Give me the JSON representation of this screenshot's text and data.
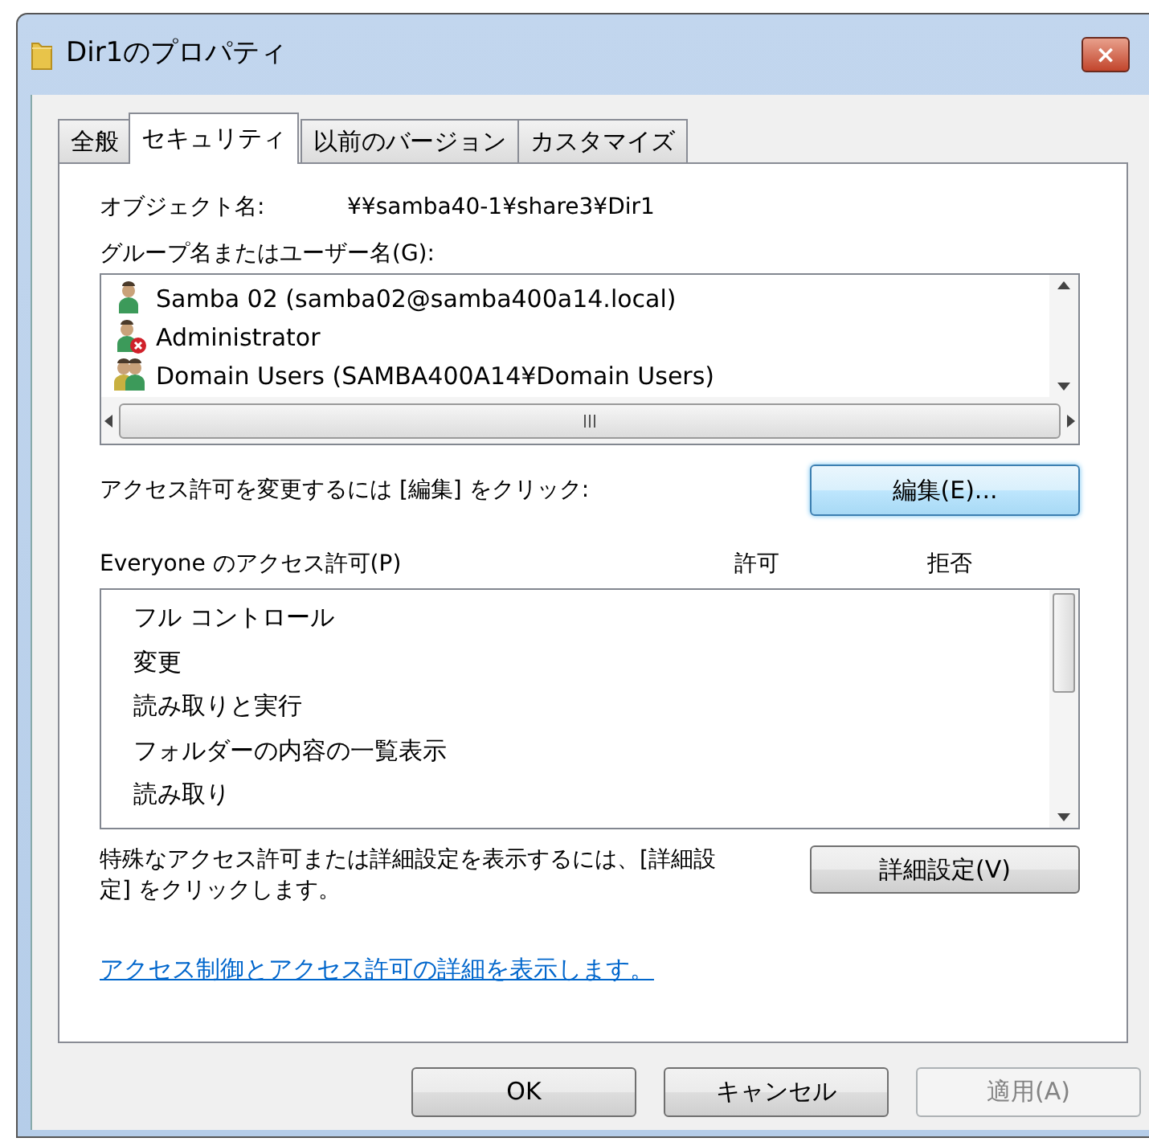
{
  "window": {
    "title": "Dir1のプロパティ",
    "close": "×"
  },
  "tabs": [
    {
      "label": "全般",
      "selected": false
    },
    {
      "label": "セキュリティ",
      "selected": true
    },
    {
      "label": "以前のバージョン",
      "selected": false
    },
    {
      "label": "カスタマイズ",
      "selected": false
    }
  ],
  "object_name": {
    "label": "オブジェクト名:",
    "value": "¥¥samba40-1¥share3¥Dir1"
  },
  "principals": {
    "label": "グループ名またはユーザー名(G):",
    "items": [
      {
        "kind": "user",
        "name": "Samba 02 (samba02@samba400a14.local)"
      },
      {
        "kind": "denied-user",
        "name": "Administrator"
      },
      {
        "kind": "group",
        "name": "Domain Users (SAMBA400A14¥Domain Users)"
      }
    ]
  },
  "edit": {
    "text": "アクセス許可を変更するには [編集] をクリック:",
    "button": "編集(E)...",
    "highlighted": true
  },
  "permissions": {
    "label": "Everyone のアクセス許可(P)",
    "columns": [
      "許可",
      "拒否"
    ],
    "items": [
      "フル コントロール",
      "変更",
      "読み取りと実行",
      "フォルダーの内容の一覧表示",
      "読み取り"
    ]
  },
  "advanced": {
    "text": "特殊なアクセス許可または詳細設定を表示するには、[詳細設定] をクリックします。",
    "button": "詳細設定(V)",
    "highlighted": false
  },
  "link": "アクセス制御とアクセス許可の詳細を表示します。",
  "buttons": [
    {
      "label": "OK",
      "disabled": false
    },
    {
      "label": "キャンセル",
      "disabled": false
    },
    {
      "label": "適用(A)",
      "disabled": true
    }
  ]
}
